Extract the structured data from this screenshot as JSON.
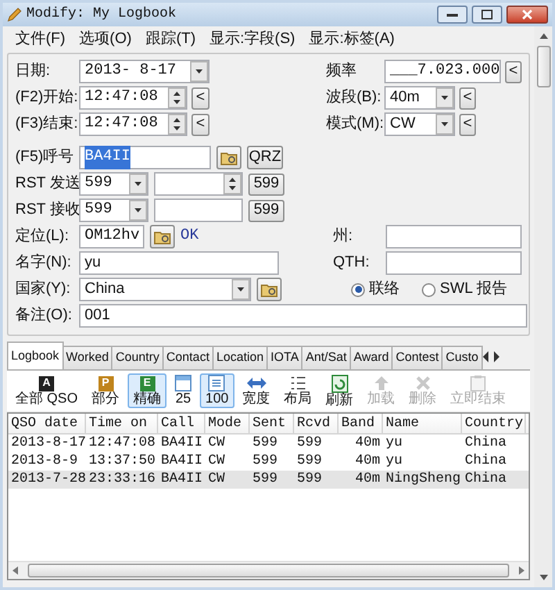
{
  "window": {
    "title": "Modify: My Logbook"
  },
  "menu": [
    {
      "label": "文件(F)"
    },
    {
      "label": "选项(O)"
    },
    {
      "label": "跟踪(T)"
    },
    {
      "label": "显示:字段(S)"
    },
    {
      "label": "显示:标签(A)"
    }
  ],
  "form": {
    "date": {
      "label": "日期:",
      "value": "2013- 8-17"
    },
    "start": {
      "label": "(F2)开始:",
      "value": "12:47:08",
      "button": "<"
    },
    "end": {
      "label": "(F3)结束:",
      "value": "12:47:08",
      "button": "<"
    },
    "call": {
      "label": "(F5)呼号",
      "value": "BA4II",
      "text_selected": true,
      "button": "QRZ"
    },
    "rst_sent": {
      "label": "RST 发送",
      "value": "599",
      "button": "599"
    },
    "rst_rcvd": {
      "label": "RST 接收",
      "value": "599",
      "button": "599"
    },
    "locator": {
      "label": "定位(L):",
      "value": "OM12hv",
      "status": "OK"
    },
    "name": {
      "label": "名字(N):",
      "value": "yu"
    },
    "country": {
      "label": "国家(Y):",
      "value": "China"
    },
    "note": {
      "label": "备注(O):",
      "value": "001"
    },
    "frequency": {
      "label": "频率",
      "value": "___7.023.000",
      "button": "<"
    },
    "band": {
      "label": "波段(B):",
      "value": "40m",
      "button": "<"
    },
    "mode": {
      "label": "模式(M):",
      "value": "CW",
      "button": "<"
    },
    "state": {
      "label": "州:"
    },
    "qth": {
      "label": "QTH:"
    },
    "qso_type": [
      {
        "label": "联络",
        "selected": true
      },
      {
        "label": "SWL 报告",
        "selected": false
      }
    ]
  },
  "tabs": [
    {
      "label": "Logbook",
      "selected": true
    },
    {
      "label": "Worked",
      "selected": false
    },
    {
      "label": "Country",
      "selected": false
    },
    {
      "label": "Contact",
      "selected": false
    },
    {
      "label": "Location",
      "selected": false
    },
    {
      "label": "IOTA",
      "selected": false
    },
    {
      "label": "Ant/Sat",
      "selected": false
    },
    {
      "label": "Award",
      "selected": false
    },
    {
      "label": "Contest",
      "selected": false
    },
    {
      "label": "Custo",
      "selected": false
    }
  ],
  "toolbar": [
    {
      "label": "全部 QSO",
      "kind": "letter",
      "glyph": "A",
      "color": "#222222",
      "selected": false,
      "disabled": false
    },
    {
      "label": "部分",
      "kind": "letter",
      "glyph": "P",
      "color": "#c0841c",
      "selected": false,
      "disabled": false
    },
    {
      "label": "精确",
      "kind": "letter",
      "glyph": "E",
      "color": "#2e8b3a",
      "selected": true,
      "disabled": false
    },
    {
      "label": "25",
      "kind": "page",
      "selected": false,
      "disabled": false
    },
    {
      "label": "100",
      "kind": "list",
      "selected": true,
      "disabled": false
    },
    {
      "label": "宽度",
      "kind": "width",
      "selected": false,
      "disabled": false
    },
    {
      "label": "布局",
      "kind": "layout",
      "selected": false,
      "disabled": false
    },
    {
      "label": "刷新",
      "kind": "refresh",
      "selected": false,
      "disabled": false
    },
    {
      "label": "加载",
      "kind": "load",
      "selected": false,
      "disabled": true
    },
    {
      "label": "删除",
      "kind": "delete",
      "selected": false,
      "disabled": true
    },
    {
      "label": "立即结束",
      "kind": "finish",
      "selected": false,
      "disabled": true
    }
  ],
  "table": {
    "columns": [
      "QSO date",
      "Time on",
      "Call",
      "Mode",
      "Sent",
      "Rcvd",
      "Band",
      "Name",
      "Country"
    ],
    "rows": [
      {
        "cells": [
          "2013-8-17",
          "12:47:08",
          "BA4II",
          "CW",
          "599",
          "599",
          "40m",
          "yu",
          "China"
        ],
        "selected": false
      },
      {
        "cells": [
          "2013-8-9",
          "13:37:50",
          "BA4II",
          "CW",
          "599",
          "599",
          "40m",
          "yu",
          "China"
        ],
        "selected": false
      },
      {
        "cells": [
          "2013-7-28",
          "23:33:16",
          "BA4II",
          "CW",
          "599",
          "599",
          "40m",
          "NingSheng",
          "China"
        ],
        "selected": true
      }
    ]
  }
}
